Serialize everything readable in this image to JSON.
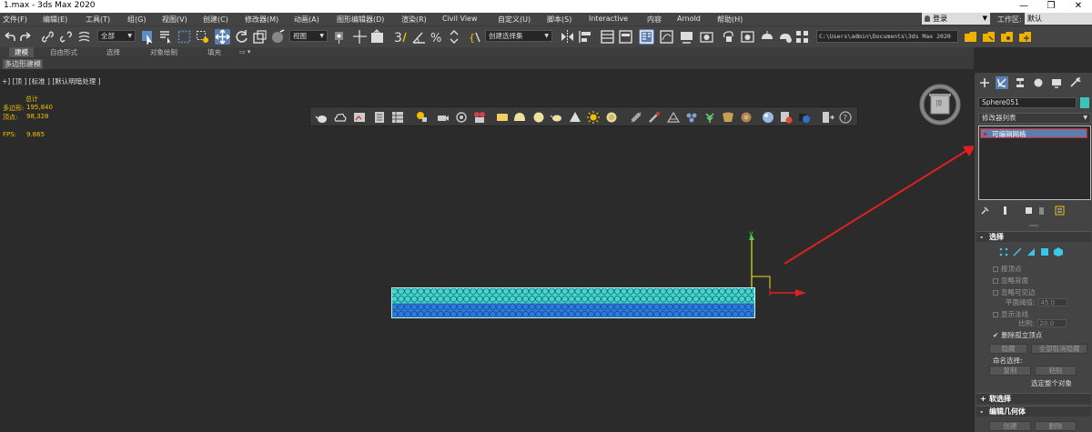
{
  "window": {
    "title": "1.max - 3ds Max 2020",
    "controls": {
      "minimize": "—",
      "restore": "❐",
      "close": "✕"
    }
  },
  "menu": {
    "items": [
      "文件(F)",
      "编辑(E)",
      "工具(T)",
      "组(G)",
      "视图(V)",
      "创建(C)",
      "修改器(M)",
      "动画(A)",
      "图形编辑器(D)",
      "渲染(R)",
      "Civil View",
      "自定义(U)",
      "脚本(S)",
      "Interactive",
      "内容",
      "Arnold",
      "帮助(H)"
    ],
    "login": "登录",
    "workspace_label": "工作区:",
    "workspace_value": "默认"
  },
  "toolbar": {
    "selection_filter": "全部",
    "ref_coord": "视图",
    "named_selection": "创建选择集",
    "project_path": "C:\\Users\\admin\\Documents\\3ds Max 2020"
  },
  "ribbon": {
    "tabs": [
      "建模",
      "自由形式",
      "选择",
      "对象绘制",
      "填充"
    ],
    "active_tab": "建模",
    "toggle": "▭ ▾",
    "sub_label": "多边形建模"
  },
  "viewport": {
    "label": "+] [顶 ] [标准 ] [默认明暗处理 ]",
    "stats": {
      "total_label": "总计",
      "polys_label": "多边形:",
      "polys_value": "195,840",
      "verts_label": "顶点:",
      "verts_value": "98,328",
      "fps_label": "FPS:",
      "fps_value": "9.865"
    },
    "viewcube_label": "顶",
    "axis_y": "y",
    "colors": {
      "mesh_top": "#40d8c8",
      "mesh_bottom": "#2a7be0",
      "annotation": "#e02020"
    }
  },
  "command_panel": {
    "object_name": "Sphere051",
    "object_color": "#3cc4bc",
    "modifier_list_label": "修改器列表",
    "stack_item": "可编辑网格",
    "selection_rollout": {
      "title": "选择",
      "sign": "-",
      "by_vertex": "按顶点",
      "ignore_backfacing": "忽略背面",
      "ignore_visible_edges": "忽略可见边",
      "planar_threshold_label": "平面阈值:",
      "planar_threshold_value": "45.0",
      "show_normals": "显示法线",
      "scale_label": "比例:",
      "scale_value": "20.0",
      "delete_isolated": "删除孤立顶点",
      "hide_button": "隐藏",
      "unhide_all_button": "全部取消隐藏",
      "named_selections_label": "命名选择:",
      "copy_button": "复制",
      "paste_button": "粘贴",
      "selected_status": "选定整个对象"
    },
    "soft_selection": {
      "title": "软选择",
      "sign": "+"
    },
    "edit_geometry": {
      "title": "编辑几何体",
      "sign": "-",
      "create_button": "创建",
      "delete_button": "删除"
    }
  }
}
